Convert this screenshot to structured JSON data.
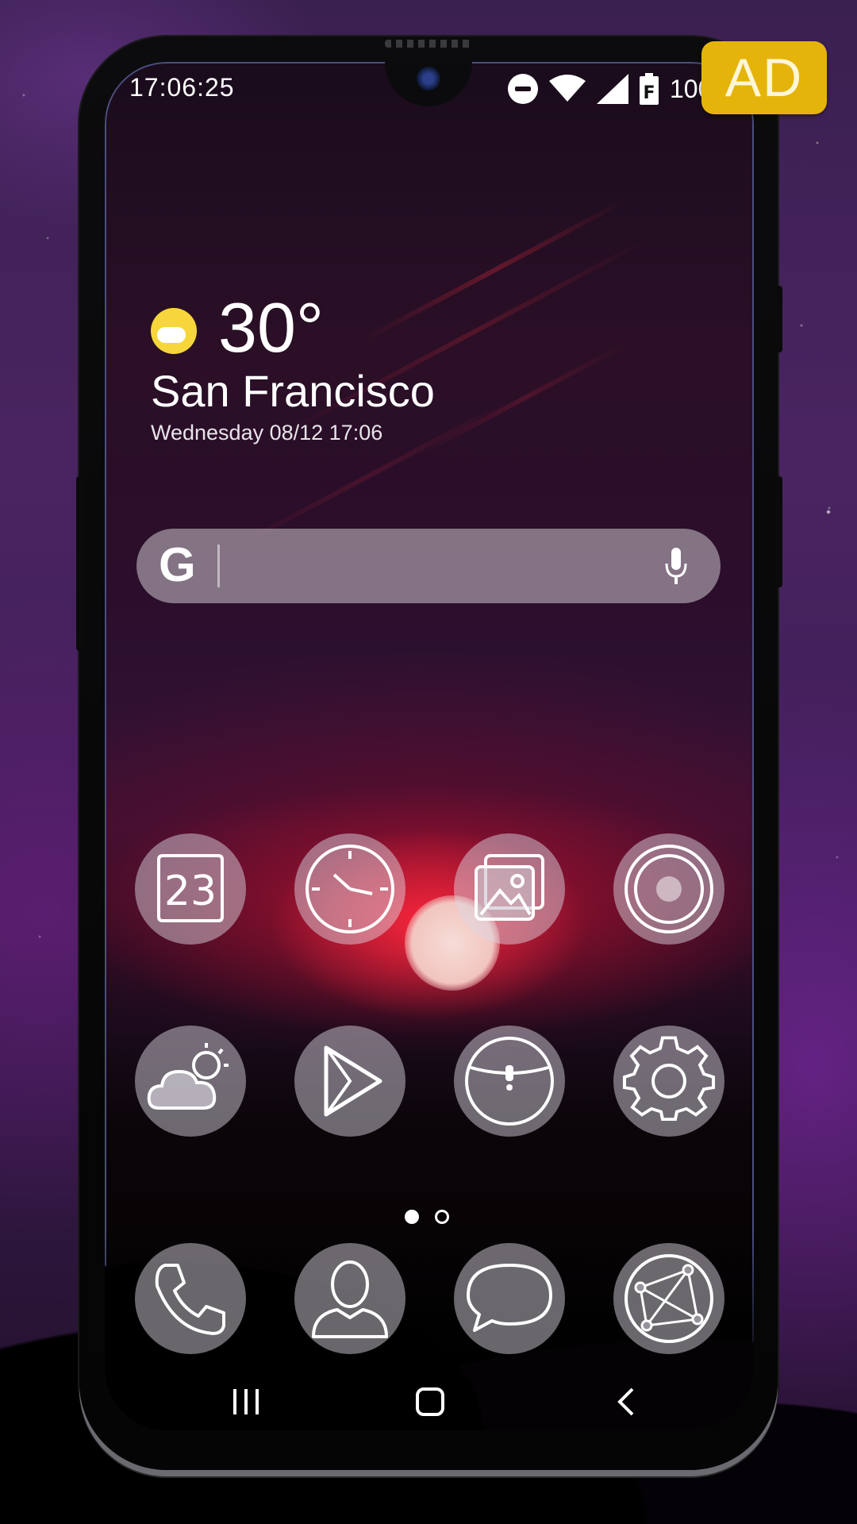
{
  "status_bar": {
    "time": "17:06:25",
    "battery_text": "100",
    "icons": [
      "do-not-disturb-icon",
      "wifi-icon",
      "cellular-signal-icon",
      "battery-icon"
    ]
  },
  "ad_badge": "AD",
  "weather": {
    "temperature": "30°",
    "city": "San Francisco",
    "datetime": "Wednesday 08/12 17:06",
    "icon": "partly-cloudy-icon",
    "sun_color": "#f6d63a"
  },
  "search": {
    "logo": "G",
    "mic_icon": "microphone-icon"
  },
  "apps_row1": [
    {
      "name": "calendar",
      "icon": "calendar-icon",
      "text": "23"
    },
    {
      "name": "clock",
      "icon": "clock-icon"
    },
    {
      "name": "gallery",
      "icon": "gallery-icon"
    },
    {
      "name": "camera",
      "icon": "camera-icon"
    }
  ],
  "apps_row2": [
    {
      "name": "weather",
      "icon": "weather-icon"
    },
    {
      "name": "play-store",
      "icon": "play-store-icon"
    },
    {
      "name": "wallet",
      "icon": "wallet-icon"
    },
    {
      "name": "settings",
      "icon": "settings-icon"
    }
  ],
  "dock": [
    {
      "name": "phone",
      "icon": "phone-icon"
    },
    {
      "name": "contacts",
      "icon": "contacts-icon"
    },
    {
      "name": "messages",
      "icon": "messages-icon"
    },
    {
      "name": "browser",
      "icon": "browser-icon"
    }
  ],
  "page_indicator": {
    "current": 1,
    "total": 2
  },
  "navigation": [
    "recents-icon",
    "home-icon",
    "back-icon"
  ],
  "colors": {
    "ad_badge": "#e5b40a",
    "icon_bg": "rgba(220,215,225,0.48)"
  }
}
